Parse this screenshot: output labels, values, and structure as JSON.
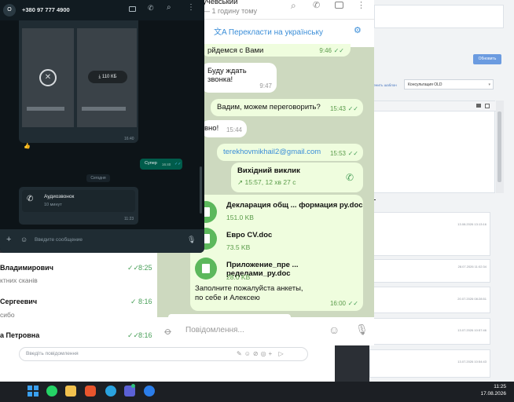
{
  "whatsapp": {
    "contact_initial": "O",
    "contact_phone": "+380 97 777 4900",
    "file_size": "110 КБ",
    "media_time": "16:40",
    "emoji": "👍",
    "sent_text": "Супер",
    "sent_time": "16:40",
    "day_separator": "Сегодня",
    "call_title": "Аудиозвонок",
    "call_duration": "10 минут",
    "call_time": "11:23",
    "input_placeholder": "Введите сообщение"
  },
  "chatlist": [
    {
      "name": "Владимирович",
      "preview": "ктних сканів",
      "time": "8:25"
    },
    {
      "name": "Сергеевич",
      "preview": "сибо",
      "time": "8:16"
    },
    {
      "name": "а Петровна",
      "preview": "",
      "time": "8:16"
    }
  ],
  "chatlist_input_placeholder": "Введіть повідомлення",
  "telegram": {
    "header_name": "учевський",
    "header_status": "1 годину тому",
    "translate_label": "Перекласти на українську",
    "messages": [
      {
        "text": "рйдемся с Вами",
        "time": "9:46",
        "out": true
      },
      {
        "text": "Буду ждать звонка!",
        "time": "9:47",
        "out": false
      },
      {
        "text": "Вадим, можем переговорить?",
        "time": "15:43",
        "out": true
      },
      {
        "text": "вно!",
        "time": "15:44",
        "out": false
      },
      {
        "text": "terekhovmikhail2@gmail.com",
        "time": "15:53",
        "out": true
      }
    ],
    "call": {
      "title": "Вихідний виклик",
      "detail": "15:57, 12 хв 27 с"
    },
    "files": [
      {
        "name": "Декларация общ ... формация ру.doc",
        "size": "151.0 KB"
      },
      {
        "name": "Евро CV.doc",
        "size": "73.5 KB"
      },
      {
        "name": "Приложение_пре ... ределами_ру.doc",
        "size": "28.0 KB"
      }
    ],
    "caption": "Заполните пожалуйста анкеты, по себе и Алексею",
    "caption_time": "16:00",
    "input_placeholder": "Повідомлення..."
  },
  "crm": {
    "update_button": "Обновить",
    "template_label": "вменить шаблон",
    "template_value": "Консультация OLD",
    "dates": [
      "13.08.2026 13:13:16",
      "28.07.2026 11:02:34",
      "20.07.2026 08:28:51",
      "13.07.2026 10:57:46",
      "13.07.2026 10:54:43"
    ]
  },
  "taskbar": {
    "time": "11:25",
    "date": "17.08.2026"
  }
}
